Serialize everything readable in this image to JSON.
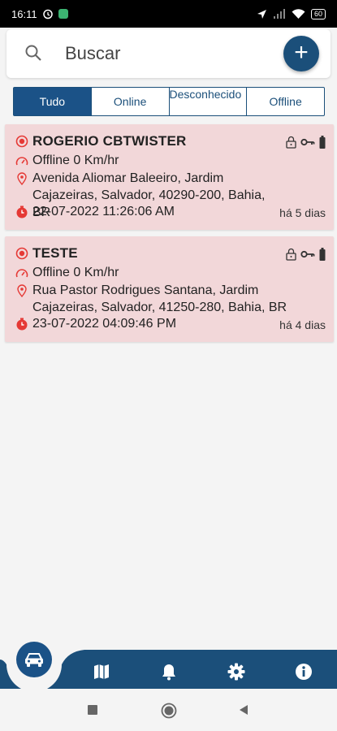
{
  "status_bar": {
    "time": "16:11",
    "battery": "60"
  },
  "search": {
    "placeholder": "Buscar"
  },
  "add_button": {
    "label": "+"
  },
  "filters": [
    {
      "label": "Tudo",
      "active": true
    },
    {
      "label": "Online",
      "active": false
    },
    {
      "label": "Desconhecido",
      "active": false
    },
    {
      "label": "Offline",
      "active": false
    }
  ],
  "vehicles": [
    {
      "name": "ROGERIO CBTWISTER",
      "status": "Offline 0 Km/hr",
      "address": "Avenida Aliomar Baleeiro, Jardim Cajazeiras, Salvador, 40290-200, Bahia, BR",
      "timestamp": "22-07-2022 11:26:06 AM",
      "ago": "há 5 dias"
    },
    {
      "name": "TESTE",
      "status": "Offline 0 Km/hr",
      "address": "Rua Pastor Rodrigues Santana, Jardim Cajazeiras, Salvador, 41250-280, Bahia, BR",
      "timestamp": "23-07-2022 04:09:46 PM",
      "ago": "há 4 dias"
    }
  ],
  "colors": {
    "primary": "#1b5287",
    "card_offline_bg": "#f2d7d9",
    "status_red": "#e53935"
  },
  "bottom_nav": [
    "car-icon",
    "map-icon",
    "bell-icon",
    "gear-icon",
    "info-icon"
  ]
}
